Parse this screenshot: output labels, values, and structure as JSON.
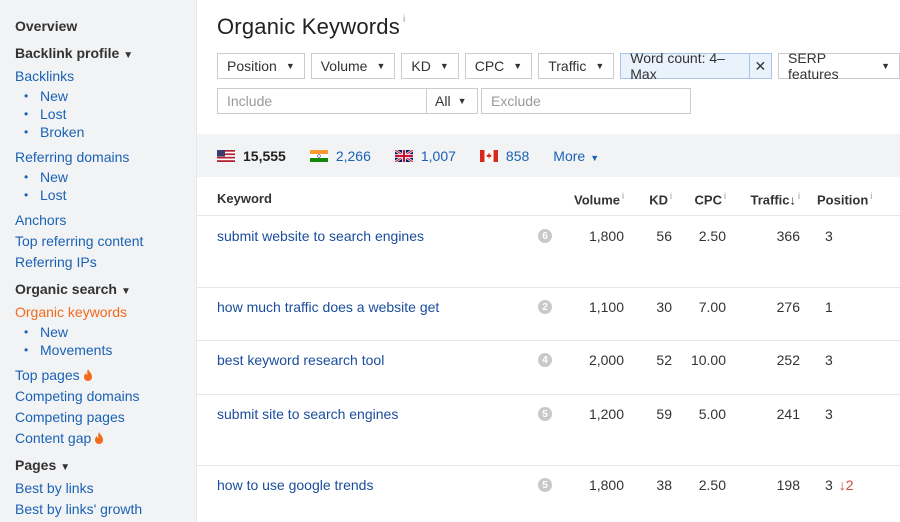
{
  "sidebar": {
    "overview": "Overview",
    "backlink_profile": "Backlink profile",
    "backlinks": "Backlinks",
    "backlinks_sub": [
      "New",
      "Lost",
      "Broken"
    ],
    "referring_domains": "Referring domains",
    "referring_domains_sub": [
      "New",
      "Lost"
    ],
    "anchors": "Anchors",
    "top_referring_content": "Top referring content",
    "referring_ips": "Referring IPs",
    "organic_search": "Organic search",
    "organic_keywords": "Organic keywords",
    "organic_keywords_sub": [
      "New",
      "Movements"
    ],
    "top_pages": "Top pages",
    "competing_domains": "Competing domains",
    "competing_pages": "Competing pages",
    "content_gap": "Content gap",
    "pages": "Pages",
    "best_by_links": "Best by links",
    "best_by_links_growth": "Best by links' growth"
  },
  "page": {
    "title": "Organic Keywords",
    "title_info": "i"
  },
  "filters": {
    "position": "Position",
    "volume": "Volume",
    "kd": "KD",
    "cpc": "CPC",
    "traffic": "Traffic",
    "word_count": "Word count: 4–Max",
    "serp_features": "SERP features"
  },
  "search": {
    "include_placeholder": "Include",
    "scope": "All",
    "exclude_placeholder": "Exclude"
  },
  "countries": [
    {
      "code": "US",
      "count": "15,555"
    },
    {
      "code": "IN",
      "count": "2,266"
    },
    {
      "code": "GB",
      "count": "1,007"
    },
    {
      "code": "CA",
      "count": "858"
    }
  ],
  "more_label": "More",
  "table": {
    "headers": {
      "keyword": "Keyword",
      "volume": "Volume",
      "kd": "KD",
      "cpc": "CPC",
      "traffic": "Traffic",
      "position": "Position",
      "info": "i"
    },
    "rows": [
      {
        "keyword": "submit website to search engines",
        "serp": "6",
        "volume": "1,800",
        "kd": "56",
        "cpc": "2.50",
        "traffic": "366",
        "position": "3",
        "change": ""
      },
      {
        "keyword": "how much traffic does a website get",
        "serp": "2",
        "volume": "1,100",
        "kd": "30",
        "cpc": "7.00",
        "traffic": "276",
        "position": "1",
        "change": ""
      },
      {
        "keyword": "best keyword research tool",
        "serp": "4",
        "volume": "2,000",
        "kd": "52",
        "cpc": "10.00",
        "traffic": "252",
        "position": "3",
        "change": ""
      },
      {
        "keyword": "submit site to search engines",
        "serp": "5",
        "volume": "1,200",
        "kd": "59",
        "cpc": "5.00",
        "traffic": "241",
        "position": "3",
        "change": ""
      },
      {
        "keyword": "how to use google trends",
        "serp": "5",
        "volume": "1,800",
        "kd": "38",
        "cpc": "2.50",
        "traffic": "198",
        "position": "3",
        "change": "↓2"
      }
    ]
  },
  "colors": {
    "link": "#1a62b5",
    "active": "#f26b1d",
    "sidebar_bg": "#f2f3f5",
    "decrease": "#d14a3c"
  }
}
